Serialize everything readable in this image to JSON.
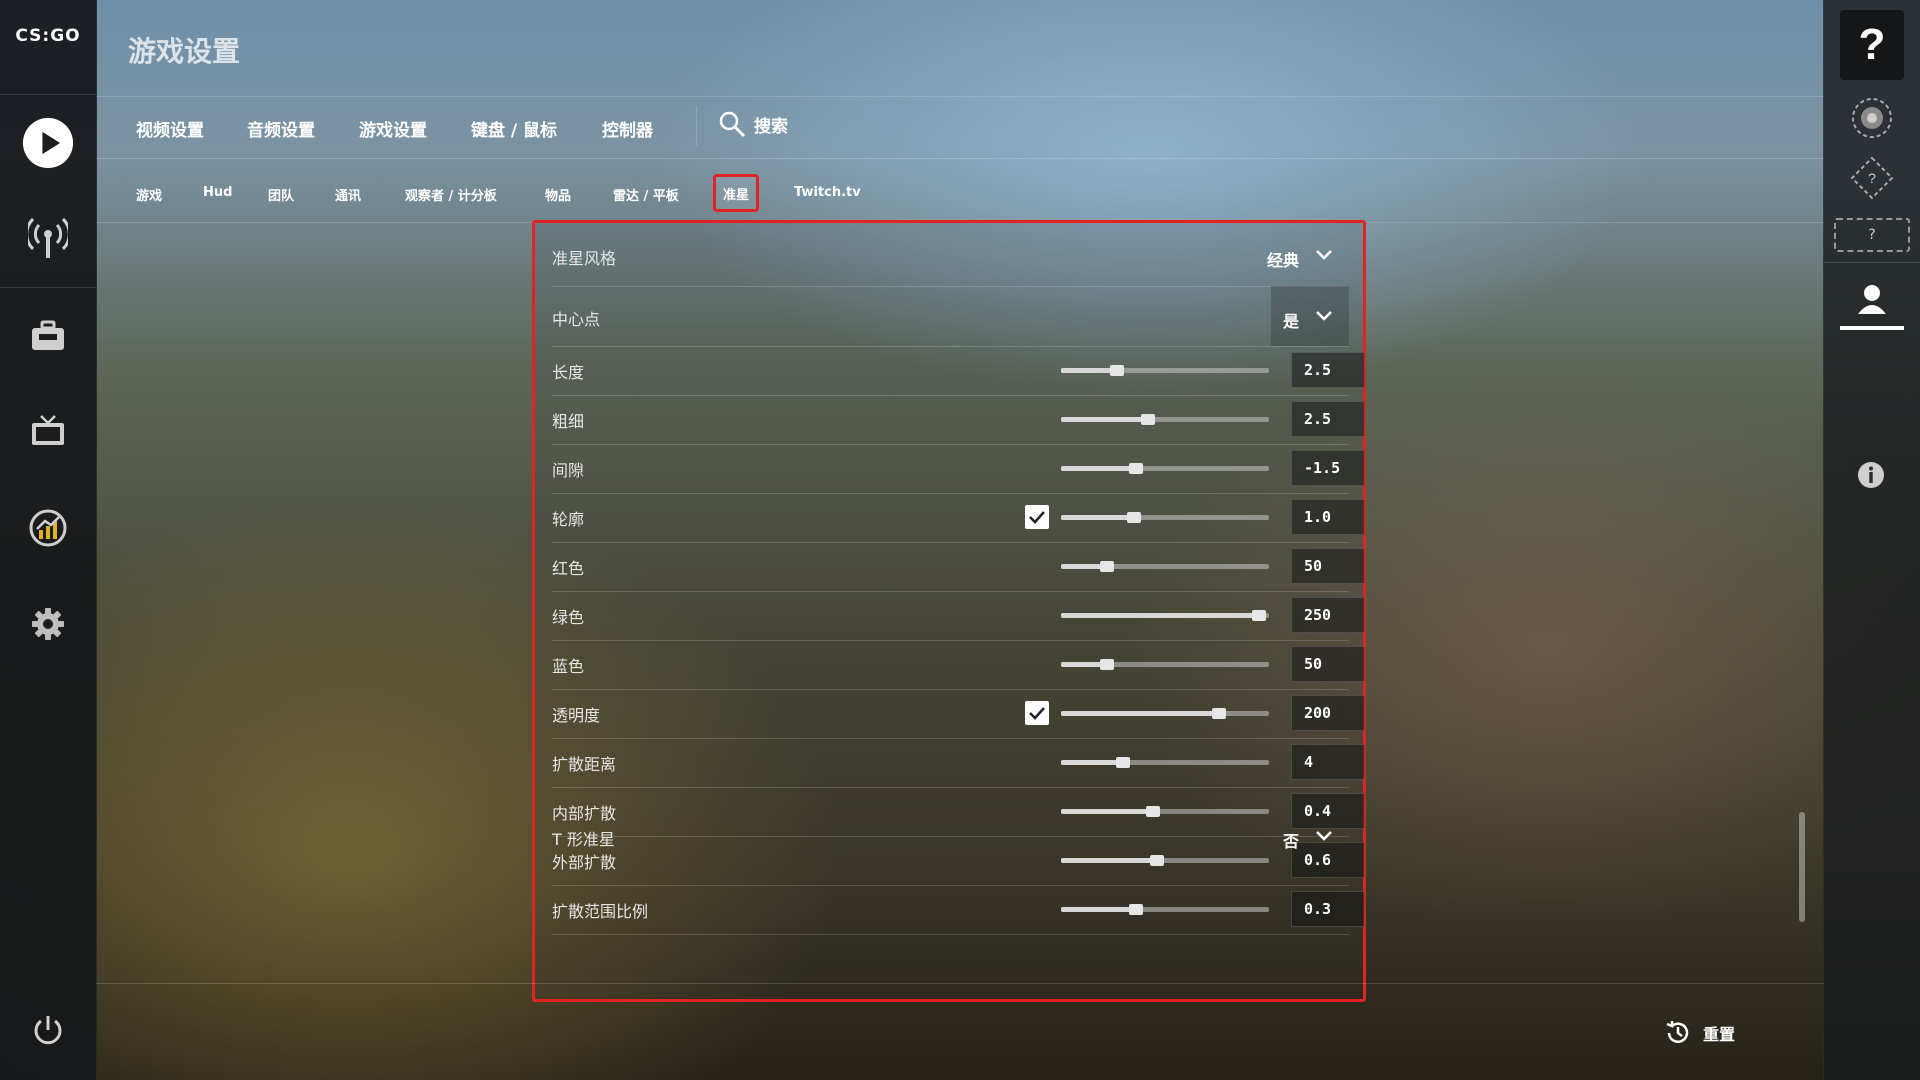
{
  "app": {
    "logo_text": "CS:GO"
  },
  "header": {
    "title": "游戏设置"
  },
  "main_tabs": [
    {
      "label": "视频设置"
    },
    {
      "label": "音频设置"
    },
    {
      "label": "游戏设置"
    },
    {
      "label": "键盘 / 鼠标"
    },
    {
      "label": "控制器"
    }
  ],
  "search": {
    "label": "搜索",
    "icon": "search-icon"
  },
  "sub_tabs": [
    {
      "label": "游戏"
    },
    {
      "label": "Hud"
    },
    {
      "label": "团队"
    },
    {
      "label": "通讯"
    },
    {
      "label": "观察者 / 计分板"
    },
    {
      "label": "物品"
    },
    {
      "label": "雷达 / 平板"
    },
    {
      "label": "准星",
      "active": true
    },
    {
      "label": "Twitch.tv"
    }
  ],
  "crosshair": {
    "style": {
      "label": "准星风格",
      "value": "经典"
    },
    "center_dot": {
      "label": "中心点",
      "value": "是"
    },
    "sliders": [
      {
        "label": "长度",
        "value": "2.5",
        "fraction": 0.27,
        "checkbox": false
      },
      {
        "label": "粗细",
        "value": "2.5",
        "fraction": 0.42,
        "checkbox": false
      },
      {
        "label": "间隙",
        "value": "-1.5",
        "fraction": 0.36,
        "checkbox": false
      },
      {
        "label": "轮廓",
        "value": "1.0",
        "fraction": 0.35,
        "checkbox": true
      },
      {
        "label": "红色",
        "value": "50",
        "fraction": 0.22,
        "checkbox": false
      },
      {
        "label": "绿色",
        "value": "250",
        "fraction": 0.95,
        "checkbox": false
      },
      {
        "label": "蓝色",
        "value": "50",
        "fraction": 0.22,
        "checkbox": false
      },
      {
        "label": "透明度",
        "value": "200",
        "fraction": 0.76,
        "checkbox": true
      },
      {
        "label": "扩散距离",
        "value": "4",
        "fraction": 0.3,
        "checkbox": false
      },
      {
        "label": "内部扩散",
        "value": "0.4",
        "fraction": 0.44,
        "checkbox": false
      },
      {
        "label": "外部扩散",
        "value": "0.6",
        "fraction": 0.46,
        "checkbox": false
      },
      {
        "label": "扩散范围比例",
        "value": "0.3",
        "fraction": 0.36,
        "checkbox": false
      }
    ],
    "t_style": {
      "label": "T 形准星",
      "value": "否"
    }
  },
  "footer": {
    "reset_label": "重置"
  },
  "right_rail": {
    "help_label": "?",
    "slot_label": "?"
  },
  "colors": {
    "highlight": "#e02424",
    "text": "#ffffff"
  }
}
